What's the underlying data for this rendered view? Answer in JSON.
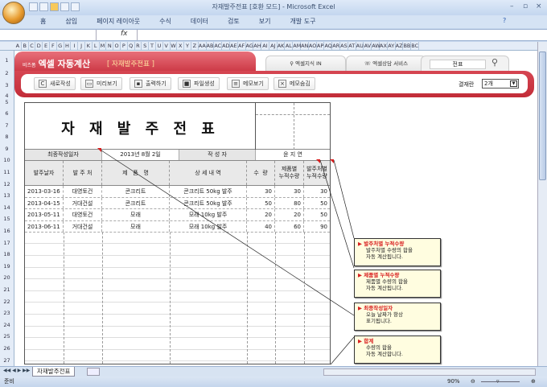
{
  "window": {
    "title": "자재발주전표  [호환 모드] - Microsoft Excel"
  },
  "ribbon": {
    "tabs": [
      "홈",
      "삽입",
      "페이지 레이아웃",
      "수식",
      "데이터",
      "검토",
      "보기",
      "개발 도구"
    ]
  },
  "formula_bar": {
    "fx": "fx"
  },
  "columns": [
    "A",
    "B",
    "C",
    "D",
    "E",
    "F",
    "G",
    "H",
    "I",
    "J",
    "K",
    "L",
    "M",
    "N",
    "O",
    "P",
    "Q",
    "R",
    "S",
    "T",
    "U",
    "V",
    "W",
    "X",
    "Y",
    "Z",
    "AA",
    "AB",
    "AC",
    "AD",
    "AE",
    "AF",
    "AG",
    "AH",
    "AI",
    "AJ",
    "AK",
    "AL",
    "AM",
    "AN",
    "AO",
    "AP",
    "AQ",
    "AR",
    "AS",
    "AT",
    "AU",
    "AV",
    "AW",
    "AX",
    "AY",
    "AZ",
    "BB",
    "BC"
  ],
  "banner": {
    "brand_small": "비즈폼",
    "brand": "엑셀 자동계산",
    "subtitle": "[ 자재발주전표 ]",
    "tab1": "엑셀지식 IN",
    "tab2": "엑셀상담 서비스",
    "search_value": "전표",
    "buttons": [
      "새로작성",
      "미리보기",
      "출력하기",
      "파일생성",
      "메모보기",
      "메모숨김"
    ],
    "approval_label": "결재란",
    "approval_value": "2개"
  },
  "form": {
    "title": "자 재 발 주 전 표",
    "last_date_label": "최종작성일자",
    "last_date": "2013년 8월 2일",
    "author_label": "작 성 자",
    "author": "윤 지 연",
    "headers": [
      "발주날자",
      "발 주 처",
      "제   품   명",
      "상 세 내 역",
      "수  량",
      "제품별\n누적수량",
      "발주처별\n누적수량"
    ],
    "rows": [
      [
        "2013-03-16",
        "대영토건",
        "콘크리트",
        "콘크리트 50kg 발주",
        "30",
        "30",
        "30"
      ],
      [
        "2013-04-15",
        "거대건설",
        "콘크리트",
        "콘크리트 50kg 발주",
        "50",
        "80",
        "50"
      ],
      [
        "2013-05-11",
        "대영토건",
        "모래",
        "모래 10kg 발주",
        "20",
        "20",
        "50"
      ],
      [
        "2013-06-11",
        "거대건설",
        "모래",
        "모래 10kg 발주",
        "40",
        "60",
        "90"
      ]
    ]
  },
  "callouts": [
    {
      "title": "발주처별 누적수량",
      "l1": "발주처별 수량의 합을",
      "l2": "자동 계산됩니다."
    },
    {
      "title": "제품별 누적수량",
      "l1": "제품별 수량의 합을",
      "l2": "자동 계산됩니다."
    },
    {
      "title": "최종작성일자",
      "l1": "오늘 날짜가 항상",
      "l2": "표기됩니다."
    },
    {
      "title": "합계",
      "l1": "수량의 합을",
      "l2": "자동 계산합니다."
    }
  ],
  "sheet_tab": "자재발주전표",
  "status": {
    "left": "준비",
    "zoom": "90%"
  }
}
